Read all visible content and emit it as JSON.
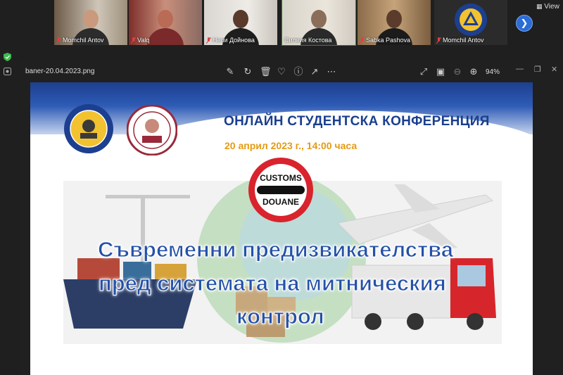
{
  "participants": [
    {
      "name": "Momchil Antov",
      "active": false
    },
    {
      "name": "Valq",
      "active": false
    },
    {
      "name": "Нели Дойнова",
      "active": false
    },
    {
      "name": "Силвия Костова",
      "active": true
    },
    {
      "name": "Sabka Pashova",
      "active": false
    },
    {
      "name": "Momchil Antov",
      "active": false
    }
  ],
  "view_label": "View",
  "viewer": {
    "file_name": "baner-20.04.2023.png",
    "zoom": "94%"
  },
  "banner": {
    "conference_title": "ОНЛАЙН СТУДЕНТСКА КОНФЕРЕНЦИЯ",
    "date_line": "20 април 2023 г., 14:00 часа",
    "sign_top": "CUSTOMS",
    "sign_bottom": "DOUANE",
    "headline_1": "Съвременни предизвикателства",
    "headline_2": "пред системата на митническия",
    "headline_3": "контрол"
  },
  "colors": {
    "accent_blue": "#2b6cd6",
    "headline_blue": "#2451a8",
    "date_orange": "#e59a12",
    "sign_red": "#d9232d"
  }
}
